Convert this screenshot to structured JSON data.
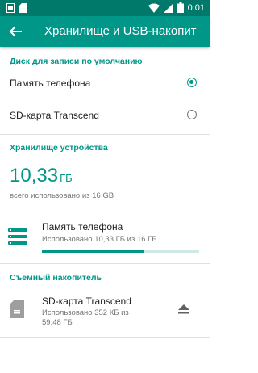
{
  "status_bar": {
    "time": "0:01",
    "icons": [
      "screenshot-icon",
      "sd-icon",
      "wifi-icon",
      "signal-icon",
      "battery-icon"
    ]
  },
  "toolbar": {
    "title": "Хранилище и USB-накопит",
    "back_icon": "arrow-back-icon"
  },
  "default_disk": {
    "header": "Диск для записи по умолчанию",
    "options": [
      {
        "label": "Память телефона",
        "selected": true
      },
      {
        "label": "SD-карта Transcend",
        "selected": false
      }
    ]
  },
  "device_storage": {
    "header": "Хранилище устройства",
    "used_value": "10,33",
    "used_unit": "ГБ",
    "used_caption": "всего использовано из 16 GB",
    "item": {
      "title": "Память телефона",
      "subtitle": "Использовано 10,33 ГБ из 16 ГБ",
      "progress_fraction": 0.65
    }
  },
  "removable": {
    "header": "Съемный накопитель",
    "item": {
      "title": "SD-карта Transcend",
      "subtitle_line1": "Использовано 352 КБ из",
      "subtitle_line2": "59,48 ГБ"
    }
  },
  "colors": {
    "accent": "#009688",
    "status_bar": "#00796b"
  }
}
